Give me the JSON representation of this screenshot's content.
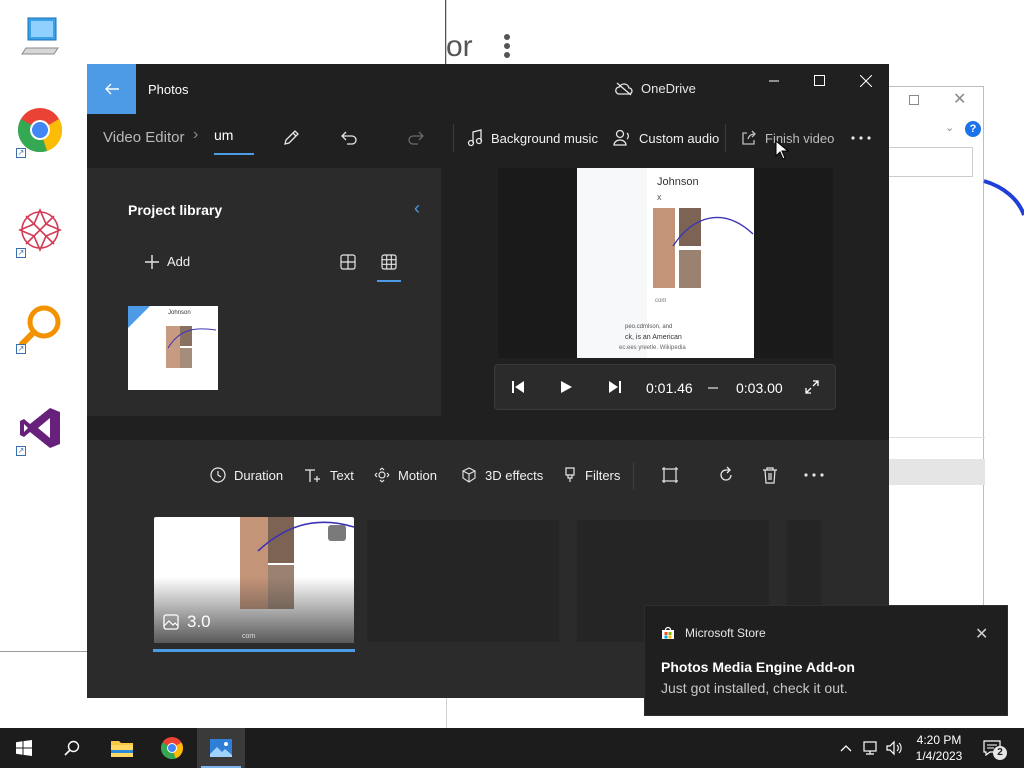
{
  "background": {
    "left_window_text": "or",
    "bottom_text": "com"
  },
  "app": {
    "title": "Photos",
    "onedrive_label": "OneDrive",
    "breadcrumb": {
      "root": "Video Editor",
      "project_name": "um"
    },
    "toolbar": {
      "background_music": "Background music",
      "custom_audio": "Custom audio",
      "finish_video": "Finish video"
    },
    "library": {
      "title": "Project library",
      "add_label": "Add",
      "thumb_text": "Johnson"
    },
    "preview": {
      "name_text": "Johnson",
      "mark_text": "x",
      "caption_line1": "peo.cdmlson, and",
      "caption_line2": "ck, is an American",
      "caption_line3": "ec.ees yreetle. Wikipedia",
      "com_text": "com"
    },
    "player": {
      "current_time": "0:01.46",
      "total_time": "0:03.00"
    },
    "storyboard": {
      "tools": {
        "duration": "Duration",
        "text": "Text",
        "motion": "Motion",
        "effects_3d": "3D effects",
        "filters": "Filters"
      },
      "clip_duration": "3.0",
      "clip_caption": "com"
    }
  },
  "toast": {
    "app_name": "Microsoft Store",
    "title": "Photos Media Engine Add-on",
    "body": "Just got installed, check it out."
  },
  "taskbar": {
    "time": "4:20 PM",
    "date": "1/4/2023",
    "notification_count": "2"
  },
  "colors": {
    "accent": "#4d9be6",
    "app_bg": "#202020",
    "panel_bg": "#2b2b2b",
    "taskbar_bg": "#1c1c1c",
    "chrome_red": "#ea4335",
    "chrome_yellow": "#fbbc05",
    "chrome_green": "#34a853",
    "chrome_blue": "#4285f4",
    "vs_purple": "#68217a"
  }
}
